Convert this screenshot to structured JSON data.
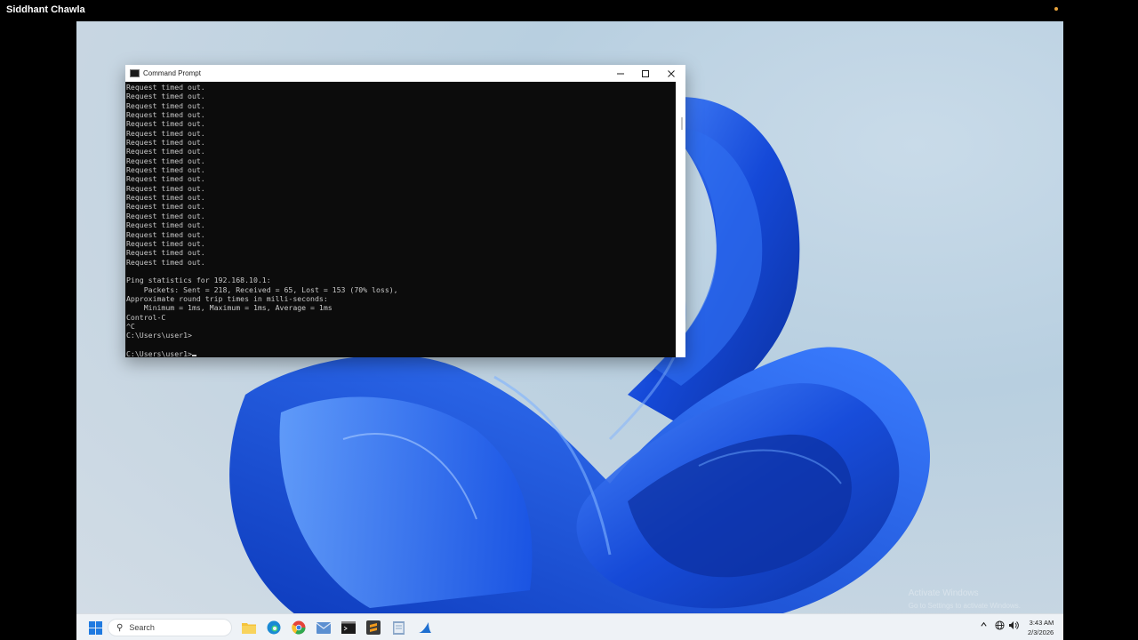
{
  "presenter": {
    "name": "Siddhant Chawla"
  },
  "colors": {
    "accent": "#1f5fe0",
    "console_bg": "#0c0c0c",
    "console_text": "#c8c8c8",
    "taskbar_bg": "#eef2f6"
  },
  "cmd_window": {
    "title": "Command Prompt",
    "icons": {
      "app": "cmd-icon",
      "minimize": "minimize-icon",
      "maximize": "maximize-icon",
      "close": "close-icon"
    },
    "lines": [
      "Request timed out.",
      "Request timed out.",
      "Request timed out.",
      "Request timed out.",
      "Request timed out.",
      "Request timed out.",
      "Request timed out.",
      "Request timed out.",
      "Request timed out.",
      "Request timed out.",
      "Request timed out.",
      "Request timed out.",
      "Request timed out.",
      "Request timed out.",
      "Request timed out.",
      "Request timed out.",
      "Request timed out.",
      "Request timed out.",
      "Request timed out.",
      "Request timed out.",
      "",
      "Ping statistics for 192.168.10.1:",
      "    Packets: Sent = 218, Received = 65, Lost = 153 (70% loss),",
      "Approximate round trip times in milli-seconds:",
      "    Minimum = 1ms, Maximum = 1ms, Average = 1ms",
      "Control-C",
      "^C",
      "C:\\Users\\user1>",
      ""
    ],
    "prompt": "C:\\Users\\user1>"
  },
  "watermark": {
    "line1": "Activate Windows",
    "line2": "Go to Settings to activate Windows."
  },
  "taskbar": {
    "search_placeholder": "Search",
    "icons": [
      "windows-start-icon",
      "search-icon",
      "file-explorer-icon",
      "edge-icon",
      "chrome-icon",
      "mail-icon",
      "terminal-icon",
      "sublime-text-icon",
      "notepad-icon",
      "wireshark-icon"
    ],
    "tray_icons": [
      "chevron-up-icon",
      "network-icon",
      "volume-icon"
    ],
    "time": "3:43 AM",
    "date": "2/3/2026"
  }
}
